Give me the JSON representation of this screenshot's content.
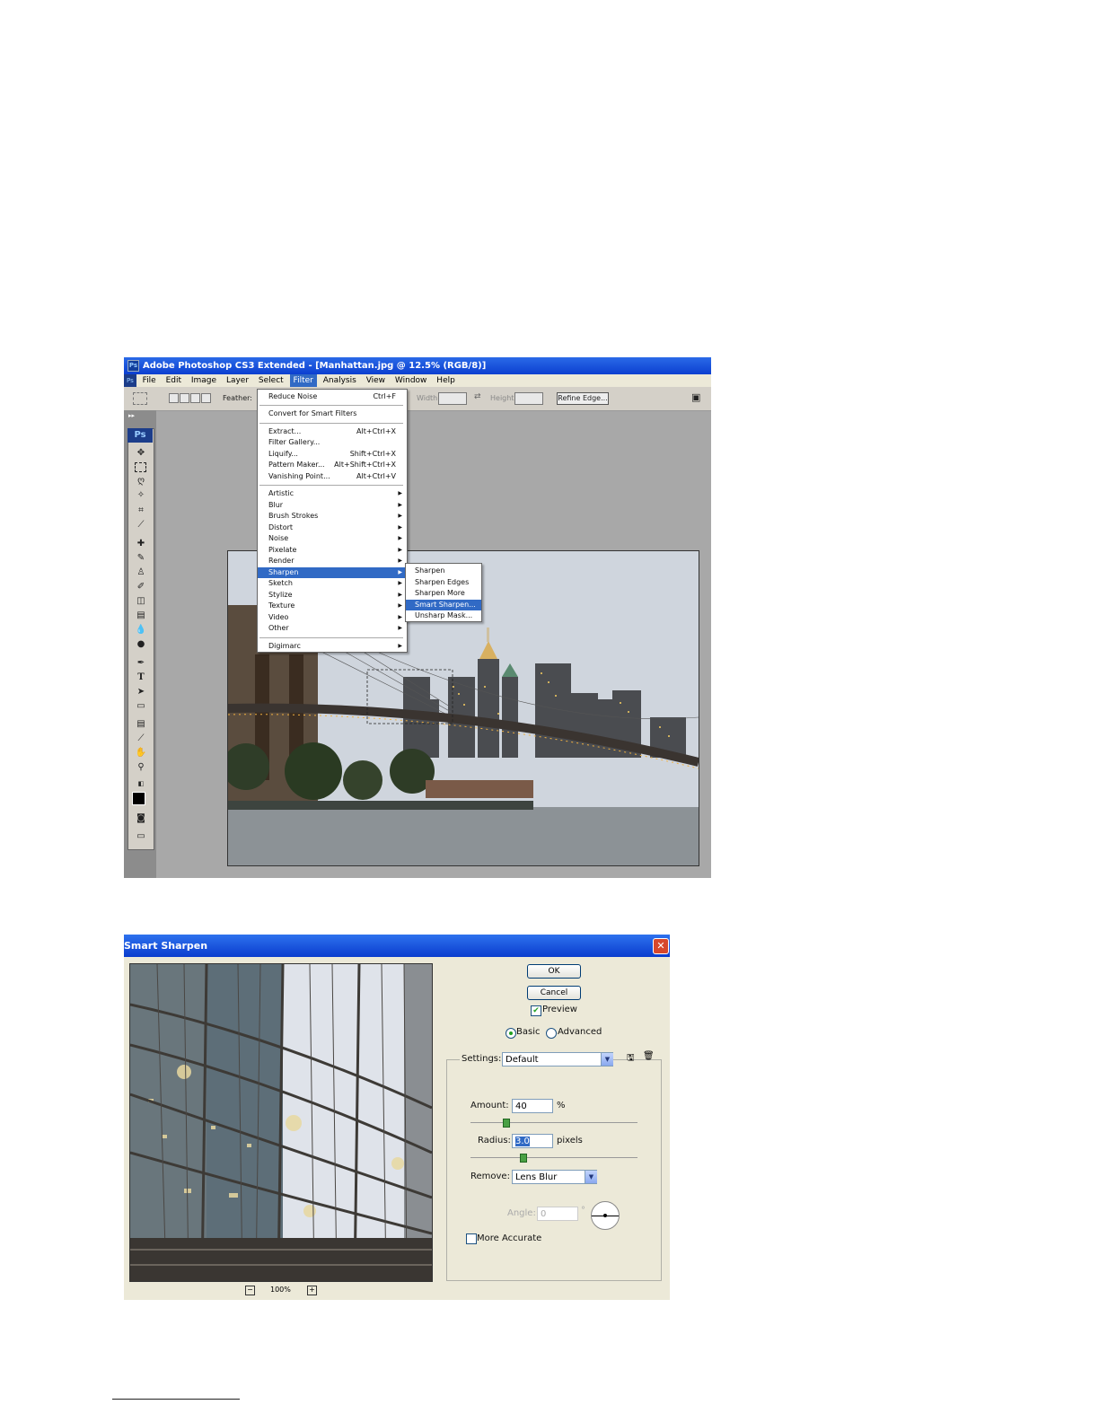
{
  "photoshop": {
    "title": "Adobe Photoshop CS3 Extended - [Manhattan.jpg @ 12.5% (RGB/8)]",
    "menu": [
      "File",
      "Edit",
      "Image",
      "Layer",
      "Select",
      "Filter",
      "Analysis",
      "View",
      "Window",
      "Help"
    ],
    "active_menu": "Filter",
    "options_bar": {
      "feather_label": "Feather:",
      "width_label": "Width:",
      "height_label": "Height:",
      "refine_edge_button": "Refine Edge..."
    },
    "ps_logo": "Ps",
    "filter_menu": {
      "items": [
        {
          "label": "Reduce Noise",
          "shortcut": "Ctrl+F"
        },
        {
          "label": "Convert for Smart Filters",
          "shortcut": ""
        },
        {
          "label": "Extract...",
          "shortcut": "Alt+Ctrl+X"
        },
        {
          "label": "Filter Gallery...",
          "shortcut": ""
        },
        {
          "label": "Liquify...",
          "shortcut": "Shift+Ctrl+X"
        },
        {
          "label": "Pattern Maker...",
          "shortcut": "Alt+Shift+Ctrl+X"
        },
        {
          "label": "Vanishing Point...",
          "shortcut": "Alt+Ctrl+V"
        },
        {
          "label": "Artistic",
          "shortcut": ""
        },
        {
          "label": "Blur",
          "shortcut": ""
        },
        {
          "label": "Brush Strokes",
          "shortcut": ""
        },
        {
          "label": "Distort",
          "shortcut": ""
        },
        {
          "label": "Noise",
          "shortcut": ""
        },
        {
          "label": "Pixelate",
          "shortcut": ""
        },
        {
          "label": "Render",
          "shortcut": ""
        },
        {
          "label": "Sharpen",
          "shortcut": ""
        },
        {
          "label": "Sketch",
          "shortcut": ""
        },
        {
          "label": "Stylize",
          "shortcut": ""
        },
        {
          "label": "Texture",
          "shortcut": ""
        },
        {
          "label": "Video",
          "shortcut": ""
        },
        {
          "label": "Other",
          "shortcut": ""
        },
        {
          "label": "Digimarc",
          "shortcut": ""
        }
      ],
      "highlighted": "Sharpen"
    },
    "sharpen_submenu": {
      "items": [
        "Sharpen",
        "Sharpen Edges",
        "Sharpen More",
        "Smart Sharpen...",
        "Unsharp Mask..."
      ],
      "highlighted": "Smart Sharpen..."
    }
  },
  "smart_sharpen": {
    "title": "Smart Sharpen",
    "ok_button": "OK",
    "cancel_button": "Cancel",
    "preview_label": "Preview",
    "preview_checked": true,
    "mode_basic": "Basic",
    "mode_advanced": "Advanced",
    "mode_selected": "Basic",
    "settings_label": "Settings:",
    "settings_value": "Default",
    "amount_label": "Amount:",
    "amount_value": "40",
    "amount_unit": "%",
    "radius_label": "Radius:",
    "radius_value": "3.0",
    "radius_unit": "pixels",
    "remove_label": "Remove:",
    "remove_value": "Lens Blur",
    "angle_label": "Angle:",
    "angle_value": "0",
    "angle_unit": "°",
    "more_accurate_label": "More Accurate",
    "more_accurate_checked": false,
    "zoom_value": "100%"
  },
  "colors": {
    "xp_title_blue": "#0a3cce",
    "menu_highlight": "#316ac5",
    "dialog_bg": "#ece9d8"
  }
}
